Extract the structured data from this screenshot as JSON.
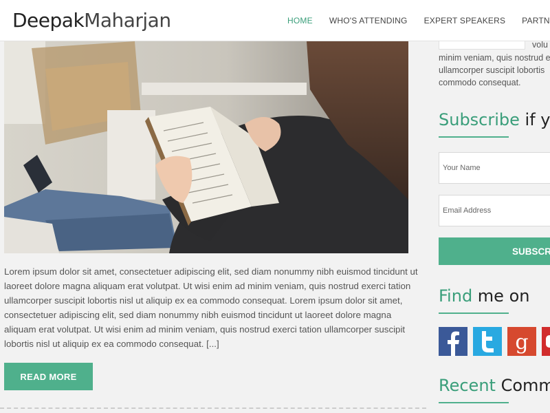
{
  "header": {
    "logo_part1": "Deepak",
    "logo_part2": "Maharjan",
    "nav": [
      "HOME",
      "WHO'S ATTENDING",
      "EXPERT SPEAKERS",
      "PARTNERS"
    ]
  },
  "post": {
    "paragraph": "Lorem ipsum dolor sit amet, consectetuer adipiscing elit, sed diam nonummy nibh euismod tincidunt ut laoreet dolore magna aliquam erat volutpat. Ut wisi enim ad minim veniam, quis nostrud exerci tation ullamcorper suscipit lobortis nisl ut aliquip ex ea commodo consequat. Lorem ipsum dolor sit amet, consectetuer adipiscing elit, sed diam nonummy nibh euismod tincidunt ut laoreet dolore magna aliquam erat volutpat. Ut wisi enim ad minim veniam, quis nostrud exerci tation ullamcorper suscipit lobortis nisl ut aliquip ex ea commodo consequat. [...]",
    "read_more": "READ MORE"
  },
  "sidebar": {
    "snippet_volu": "volu",
    "snippet_lines": [
      "minim veniam, quis nostrud e",
      "ullamcorper suscipit lobortis",
      "commodo consequat."
    ],
    "subscribe_title_accent": "Subscribe",
    "subscribe_title_rest": " if yo",
    "name_placeholder": "Your Name",
    "email_placeholder": "Email Address",
    "subscribe_button": "SUBSCR",
    "find_title_accent": "Find",
    "find_title_rest": " me on",
    "recent_title_accent": "Recent",
    "recent_title_rest": " Comme"
  },
  "social": [
    "facebook-icon",
    "twitter-icon",
    "google-plus-icon",
    "youtube-icon"
  ],
  "colors": {
    "accent": "#4fb08c",
    "accent_text": "#3a9e7a"
  }
}
